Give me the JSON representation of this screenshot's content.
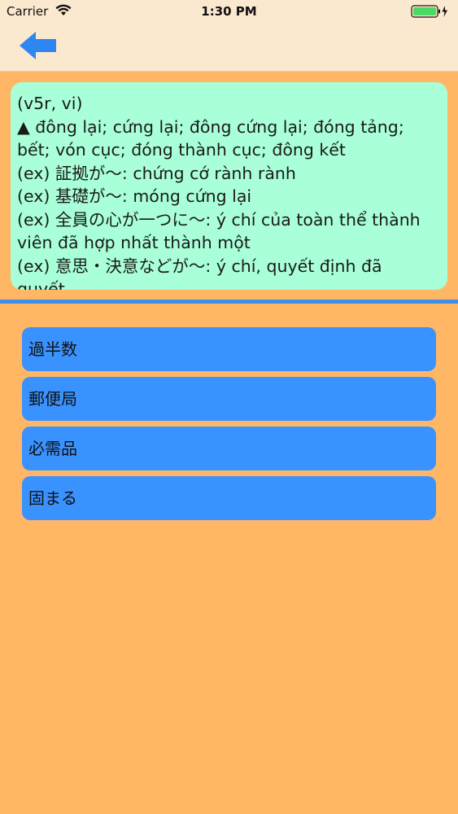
{
  "status_bar": {
    "carrier": "Carrier",
    "time": "1:30 PM"
  },
  "nav": {
    "back_icon": "arrow-left-icon",
    "accent_color": "#2e86f0"
  },
  "definition": {
    "lines": [
      "(v5r, vi)",
      "▲ đông lại; cứng lại; đông cứng lại; đóng tảng;",
      "bết; vón cục; đóng thành cục; đông kết",
      "(ex) 証拠が～: chứng cớ rành rành",
      "(ex) 基礎が～: móng cứng lại",
      "(ex) 全員の心が一つに～: ý chí của toàn thể thành",
      "viên đã hợp nhất thành một",
      "(ex) 意思・決意などが～: ý chí, quyết định đã",
      "quyết"
    ]
  },
  "choices": [
    {
      "label": "過半数"
    },
    {
      "label": "郵便局"
    },
    {
      "label": "必需品"
    },
    {
      "label": "固まる"
    }
  ]
}
